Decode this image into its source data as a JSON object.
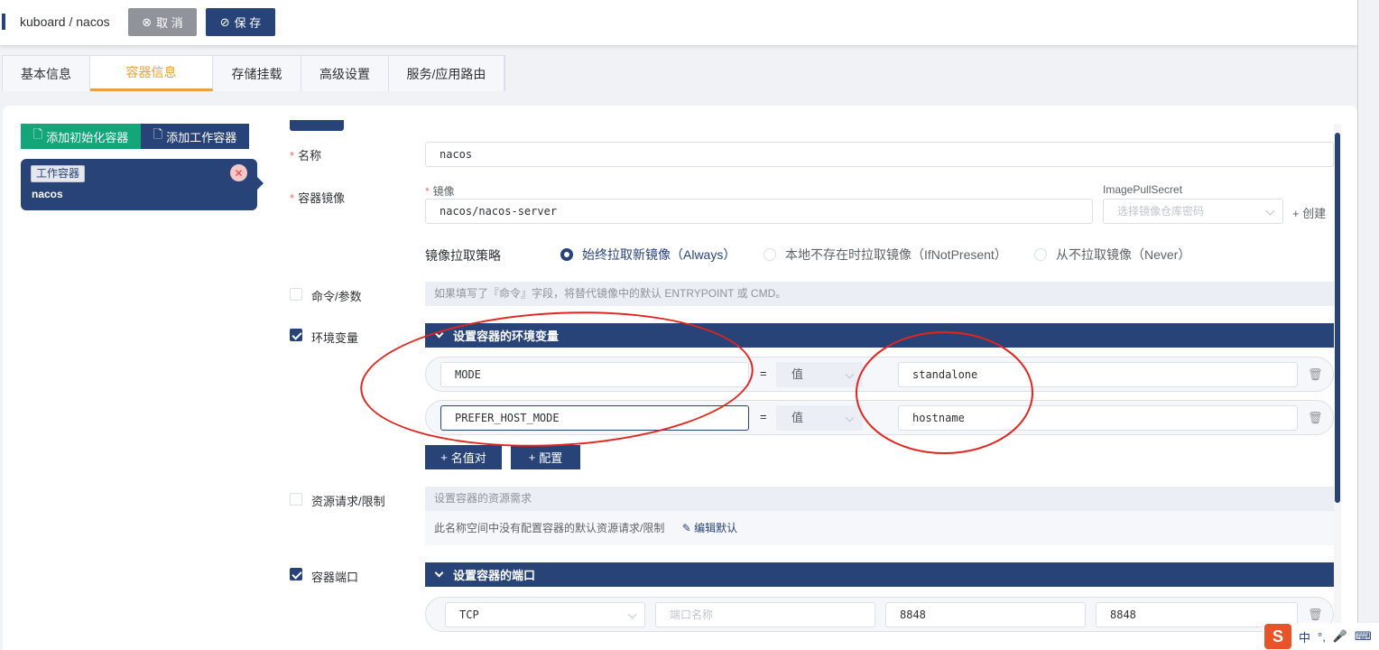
{
  "header": {
    "title": "kuboard / nacos",
    "cancel_label": "取 消",
    "save_label": "保 存"
  },
  "tabs": [
    {
      "label": "基本信息",
      "active": false
    },
    {
      "label": "容器信息",
      "active": true
    },
    {
      "label": "存储挂载",
      "active": false
    },
    {
      "label": "高级设置",
      "active": false
    },
    {
      "label": "服务/应用路由",
      "active": false
    }
  ],
  "left_panel": {
    "add_init_label": "添加初始化容器",
    "add_work_label": "添加工作容器",
    "container": {
      "tag": "工作容器",
      "name": "nacos"
    }
  },
  "form": {
    "name_label": "名称",
    "name_value": "nacos",
    "image_label": "容器镜像",
    "image_sublabel": "镜像",
    "image_value": "nacos/nacos-server",
    "secret_sublabel": "ImagePullSecret",
    "secret_placeholder": "选择镜像仓库密码",
    "create_label": "创建",
    "pull_policy_label": "镜像拉取策略",
    "pull_policies": [
      {
        "label": "始终拉取新镜像（Always）",
        "selected": true
      },
      {
        "label": "本地不存在时拉取镜像（IfNotPresent）",
        "selected": false
      },
      {
        "label": "从不拉取镜像（Never）",
        "selected": false
      }
    ],
    "command_label": "命令/参数",
    "command_checked": false,
    "command_hint": "如果填写了『命令』字段，将替代镜像中的默认 ENTRYPOINT 或 CMD。",
    "env_label": "环境变量",
    "env_checked": true,
    "env_section_title": "设置容器的环境变量",
    "env_vars": [
      {
        "name": "MODE",
        "type": "值",
        "value": "standalone"
      },
      {
        "name": "PREFER_HOST_MODE",
        "type": "值",
        "value": "hostname"
      }
    ],
    "add_kv_label": "名值对",
    "add_config_label": "配置",
    "resource_label": "资源请求/限制",
    "resource_checked": false,
    "resource_hint": "设置容器的资源需求",
    "resource_note": "此名称空间中没有配置容器的默认资源请求/限制",
    "resource_edit": "编辑默认",
    "ports_label": "容器端口",
    "ports_checked": true,
    "ports_section_title": "设置容器的端口",
    "ports": [
      {
        "protocol": "TCP",
        "name_placeholder": "端口名称",
        "container_port": "8848",
        "host_port": "8848"
      }
    ]
  },
  "ime": {
    "mode": "中"
  }
}
